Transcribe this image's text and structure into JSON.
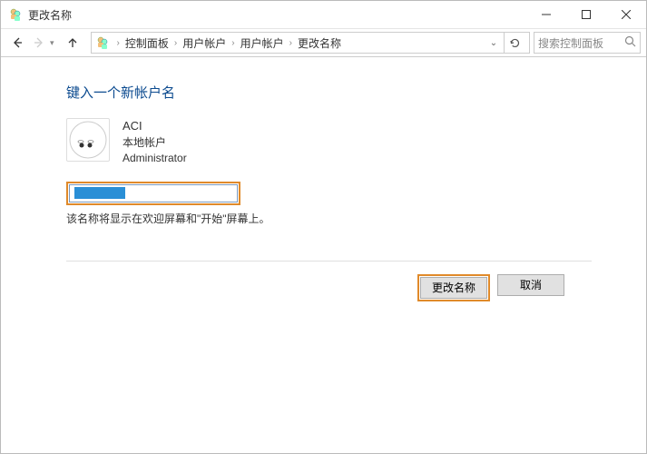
{
  "window": {
    "title": "更改名称"
  },
  "breadcrumb": {
    "items": [
      "控制面板",
      "用户帐户",
      "用户帐户",
      "更改名称"
    ]
  },
  "search": {
    "placeholder": "搜索控制面板"
  },
  "page": {
    "heading": "键入一个新帐户名",
    "help_text": "该名称将显示在欢迎屏幕和\"开始\"屏幕上。"
  },
  "account": {
    "name": "ACI",
    "type": "本地帐户",
    "role": "Administrator"
  },
  "buttons": {
    "confirm": "更改名称",
    "cancel": "取消"
  }
}
